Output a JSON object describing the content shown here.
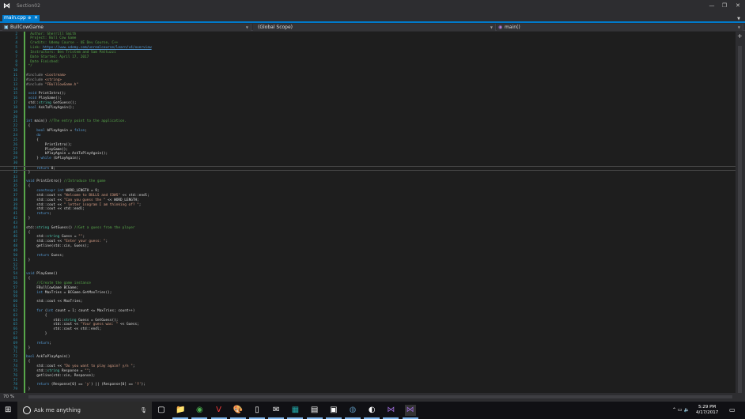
{
  "window": {
    "title": "Section02",
    "minimize": "—",
    "restore": "❐",
    "close": "✕"
  },
  "tab": {
    "label": "main.cpp",
    "pin": "⊕",
    "close": "✕"
  },
  "navbar": {
    "project": "BullCowGame",
    "scope": "(Global Scope)",
    "member": "main()"
  },
  "editor": {
    "zoom": "70 %",
    "current_line": 31,
    "first_line": 2,
    "lines": [
      "  Author: Sherrill Smith",
      "  Project: Bull Cow Game",
      "  Credits: Udemy Course - UE Dev Course, C++",
      "  Link: https://www.udemy.com/unrealcourse/learn/v4/overview",
      "  Instructors: Ben Tristem and Sam Pattuzzi",
      "  Date Started: April 17, 2017",
      "  Date Finished:",
      " */",
      "",
      "#include <iostream>",
      "#include <string>",
      "#include \"FBullCowGame.h\"",
      "",
      " void PrintIntro();",
      " void PlayGame();",
      " std::string GetGuess();",
      " bool AskToPlayAgain();",
      "",
      "",
      "int main() //The entry point to the application.",
      " {",
      "     bool bPlayAgain = false;",
      "     do",
      "     {",
      "         PrintIntro();",
      "         PlayGame();",
      "         bPlayAgain = AskToPlayAgain();",
      "     } while (bPlayAgain);",
      "",
      "     return 0;",
      " }",
      "",
      "void PrintIntro() //Introduce the game",
      " {",
      "     constexpr int WORD_LENGTH = 9;",
      "     std::cout << \"Welcome to BULLS and COWS\" << std::endl;",
      "     std::cout << \"Can you guess the \" << WORD_LENGTH;",
      "     std::cout << \" letter isogram I am thinking of? \";",
      "     std::cout << std::endl;",
      "     return;",
      " }",
      "",
      "std::string GetGuess() //Get a guess from the player",
      " {",
      "     std::string Guess = \"\";",
      "     std::cout << \"Enter your guess: \";",
      "     getline(std::cin, Guess);",
      "",
      "     return Guess;",
      " }",
      "",
      "",
      "void PlayGame()",
      " {",
      "     //Create the game instance",
      "     FBullCowGame BCGame;",
      "     int MaxTries = BCGame.GetMaxTries();",
      "",
      "     std::cout << MaxTries;",
      "",
      "     for (int count = 1; count <= MaxTries; count++)",
      "         {",
      "             std::string Guess = GetGuess();",
      "             std::cout << \"Your guess was: \" << Guess;",
      "             std::cout << std::endl;",
      "         }",
      "",
      "     return;",
      " }",
      "",
      "bool AskToPlayAgain()",
      " {",
      "     std::cout << \"Do you want to play again? y/n \";",
      "     std::string Response = \"\";",
      "     getline(std::cin, Response);",
      "",
      "     return (Response[0] == 'y') || (Response[0] == 'Y');",
      " }"
    ]
  },
  "taskbar": {
    "search_placeholder": "Ask me anything",
    "time": "5:29 PM",
    "date": "4/17/2017",
    "apps": [
      "task-view",
      "file-explorer",
      "chrome",
      "vivaldi",
      "paint",
      "notepad",
      "mail",
      "store",
      "calculator",
      "media",
      "edge-beta",
      "tor",
      "visual-studio",
      "visual-studio-2"
    ]
  }
}
